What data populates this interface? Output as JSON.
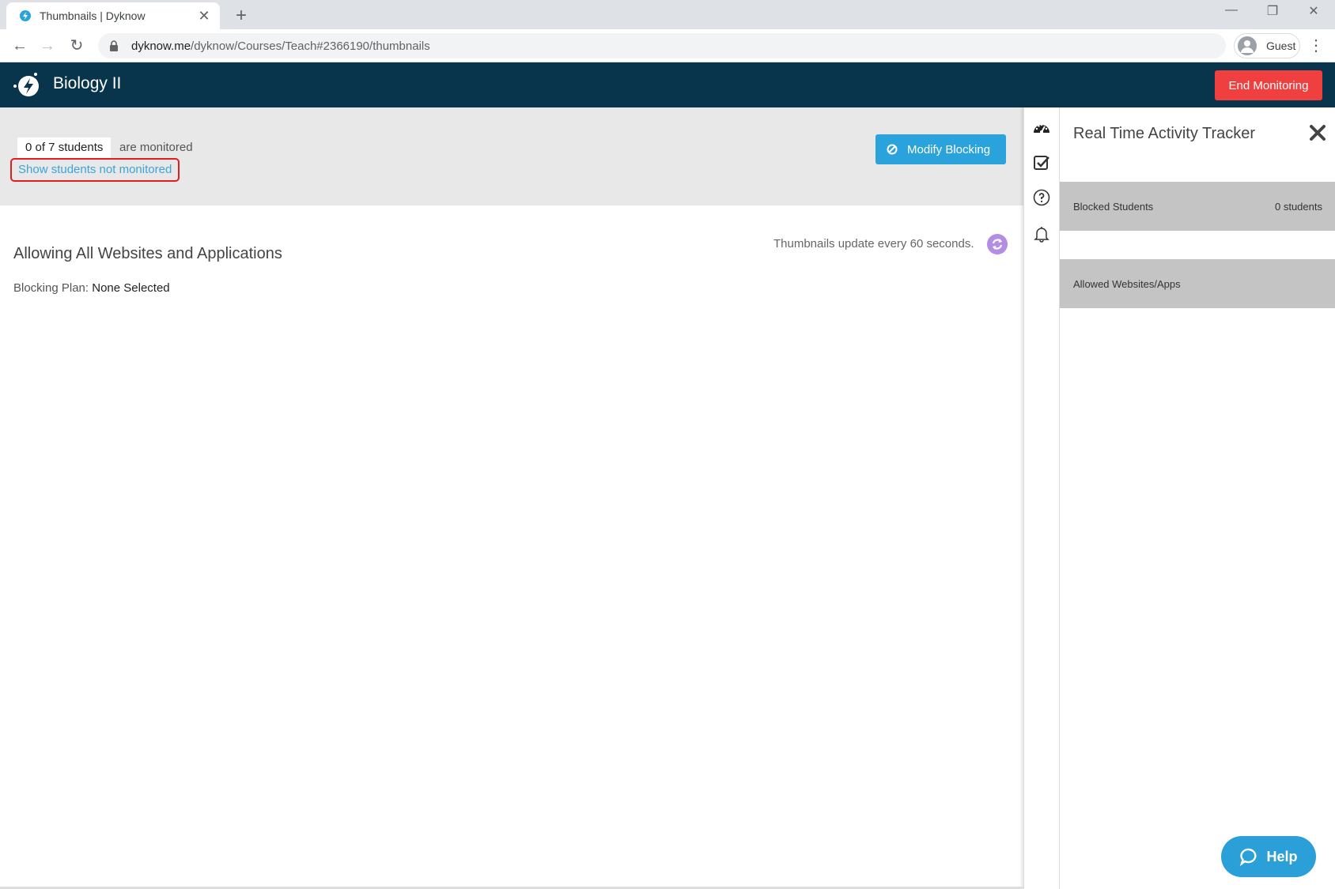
{
  "browser": {
    "tab_title": "Thumbnails | Dyknow",
    "url_host": "dyknow.me",
    "url_path": "/dyknow/Courses/Teach#2366190/thumbnails",
    "profile_label": "Guest"
  },
  "header": {
    "title": "Biology II",
    "end_label": "End Monitoring"
  },
  "monitor": {
    "count": "0 of 7 students",
    "suffix": "are monitored",
    "show_link": "Show students not monitored",
    "modify_label": "Modify Blocking"
  },
  "plan": {
    "heading": "Allowing All Websites and Applications",
    "label": "Blocking Plan:",
    "value": "None Selected",
    "update_text": "Thumbnails update every 60 seconds."
  },
  "tracker": {
    "title": "Real Time Activity Tracker",
    "blocked_label": "Blocked Students",
    "blocked_count": "0 students",
    "allowed_label": "Allowed Websites/Apps"
  },
  "help": {
    "label": "Help"
  },
  "colors": {
    "header_bg": "#08354b",
    "end_button": "#ef3f3e",
    "modify_button": "#2aa2dc",
    "link": "#3aa5d8",
    "highlight_border": "#e31d1d",
    "refresh": "#b28ce5"
  }
}
